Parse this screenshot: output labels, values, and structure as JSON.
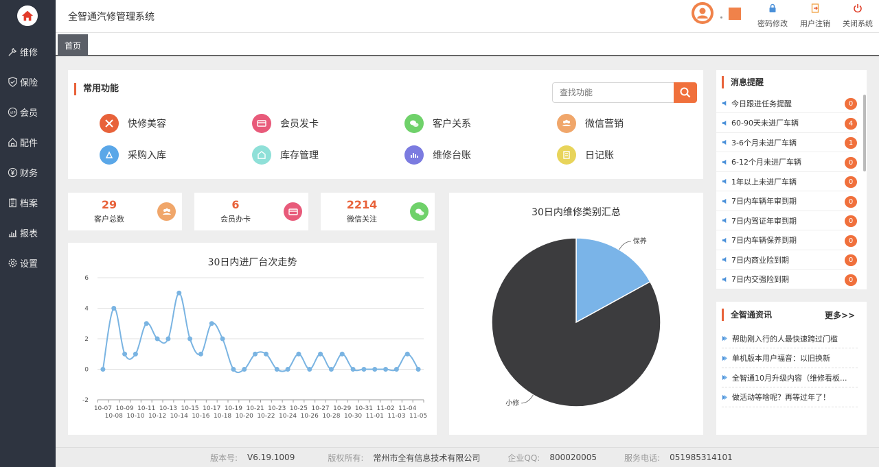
{
  "app": {
    "title": "全智通汽修管理系统"
  },
  "sidebar": {
    "items": [
      {
        "label": "维修",
        "icon": "wrench-icon"
      },
      {
        "label": "保险",
        "icon": "shield-icon"
      },
      {
        "label": "会员",
        "icon": "vip-icon"
      },
      {
        "label": "配件",
        "icon": "house-icon"
      },
      {
        "label": "财务",
        "icon": "yen-icon"
      },
      {
        "label": "档案",
        "icon": "clipboard-icon"
      },
      {
        "label": "报表",
        "icon": "bar-chart-icon"
      },
      {
        "label": "设置",
        "icon": "gear-icon"
      }
    ]
  },
  "header": {
    "actions": [
      {
        "label": "密码修改",
        "icon": "lock-icon"
      },
      {
        "label": "用户注销",
        "icon": "logout-icon"
      },
      {
        "label": "关闭系统",
        "icon": "power-icon"
      }
    ]
  },
  "tabs": {
    "home": "首页"
  },
  "functions": {
    "title": "常用功能",
    "search_placeholder": "查找功能",
    "items": [
      {
        "label": "快修美容",
        "color": "#e8623a"
      },
      {
        "label": "会员发卡",
        "color": "#e85a7a"
      },
      {
        "label": "客户关系",
        "color": "#6fd16a"
      },
      {
        "label": "微信营销",
        "color": "#f0a66a"
      },
      {
        "label": "采购入库",
        "color": "#5aa7e8"
      },
      {
        "label": "库存管理",
        "color": "#8fe0d8"
      },
      {
        "label": "维修台账",
        "color": "#7b7be0"
      },
      {
        "label": "日记账",
        "color": "#e8d45a"
      }
    ]
  },
  "stats": [
    {
      "value": "29",
      "label": "客户总数",
      "color": "#f0a66a"
    },
    {
      "value": "6",
      "label": "会员办卡",
      "color": "#e85a7a"
    },
    {
      "value": "2214",
      "label": "微信关注",
      "color": "#6fd16a"
    }
  ],
  "line_chart_title": "30日内进厂台次走势",
  "pie_chart_title": "30日内维修类别汇总",
  "chart_data": [
    {
      "type": "line",
      "title": "30日内进厂台次走势",
      "x": [
        "10-07",
        "10-08",
        "10-09",
        "10-10",
        "10-11",
        "10-12",
        "10-13",
        "10-14",
        "10-15",
        "10-16",
        "10-17",
        "10-18",
        "10-19",
        "10-20",
        "10-21",
        "10-22",
        "10-23",
        "10-24",
        "10-25",
        "10-26",
        "10-27",
        "10-28",
        "10-29",
        "10-30",
        "10-31",
        "11-01",
        "11-02",
        "11-03",
        "11-04",
        "11-05"
      ],
      "values": [
        0,
        4,
        1,
        1,
        3,
        2,
        2,
        5,
        2,
        1,
        3,
        2,
        0,
        0,
        1,
        1,
        0,
        0,
        1,
        0,
        1,
        0,
        1,
        0,
        0,
        0,
        0,
        0,
        1,
        0
      ],
      "ylim": [
        -2,
        6
      ],
      "yticks": [
        6,
        4,
        2,
        0,
        -2
      ],
      "color": "#7ab4e2"
    },
    {
      "type": "pie",
      "title": "30日内维修类别汇总",
      "slices": [
        {
          "name": "保养",
          "value": 17,
          "color": "#7ab4e8"
        },
        {
          "name": "小修",
          "value": 83,
          "color": "#3c3c3e"
        }
      ]
    }
  ],
  "messages": {
    "title": "消息提醒",
    "items": [
      {
        "label": "今日跟进任务提醒",
        "count": "0"
      },
      {
        "label": "60-90天未进厂车辆",
        "count": "4"
      },
      {
        "label": "3-6个月未进厂车辆",
        "count": "1"
      },
      {
        "label": "6-12个月未进厂车辆",
        "count": "0"
      },
      {
        "label": "1年以上未进厂车辆",
        "count": "0"
      },
      {
        "label": "7日内车辆年审到期",
        "count": "0"
      },
      {
        "label": "7日内驾证年审到期",
        "count": "0"
      },
      {
        "label": "7日内车辆保养到期",
        "count": "0"
      },
      {
        "label": "7日内商业险到期",
        "count": "0"
      },
      {
        "label": "7日内交强险到期",
        "count": "0"
      }
    ]
  },
  "news": {
    "title": "全智通资讯",
    "more": "更多>>",
    "items": [
      "帮助刚入行的人最快速跨过门槛",
      "单机版本用户福音：以旧换新",
      "全智通10月升级内容（维修看板...",
      "做活动等啥呢？再等过年了！"
    ]
  },
  "footer": {
    "version_key": "版本号:",
    "version": "V6.19.1009",
    "copyright_key": "版权所有:",
    "copyright": "常州市全有信息技术有限公司",
    "qq_key": "企业QQ:",
    "qq": "800020005",
    "phone_key": "服务电话:",
    "phone": "051985314101"
  }
}
